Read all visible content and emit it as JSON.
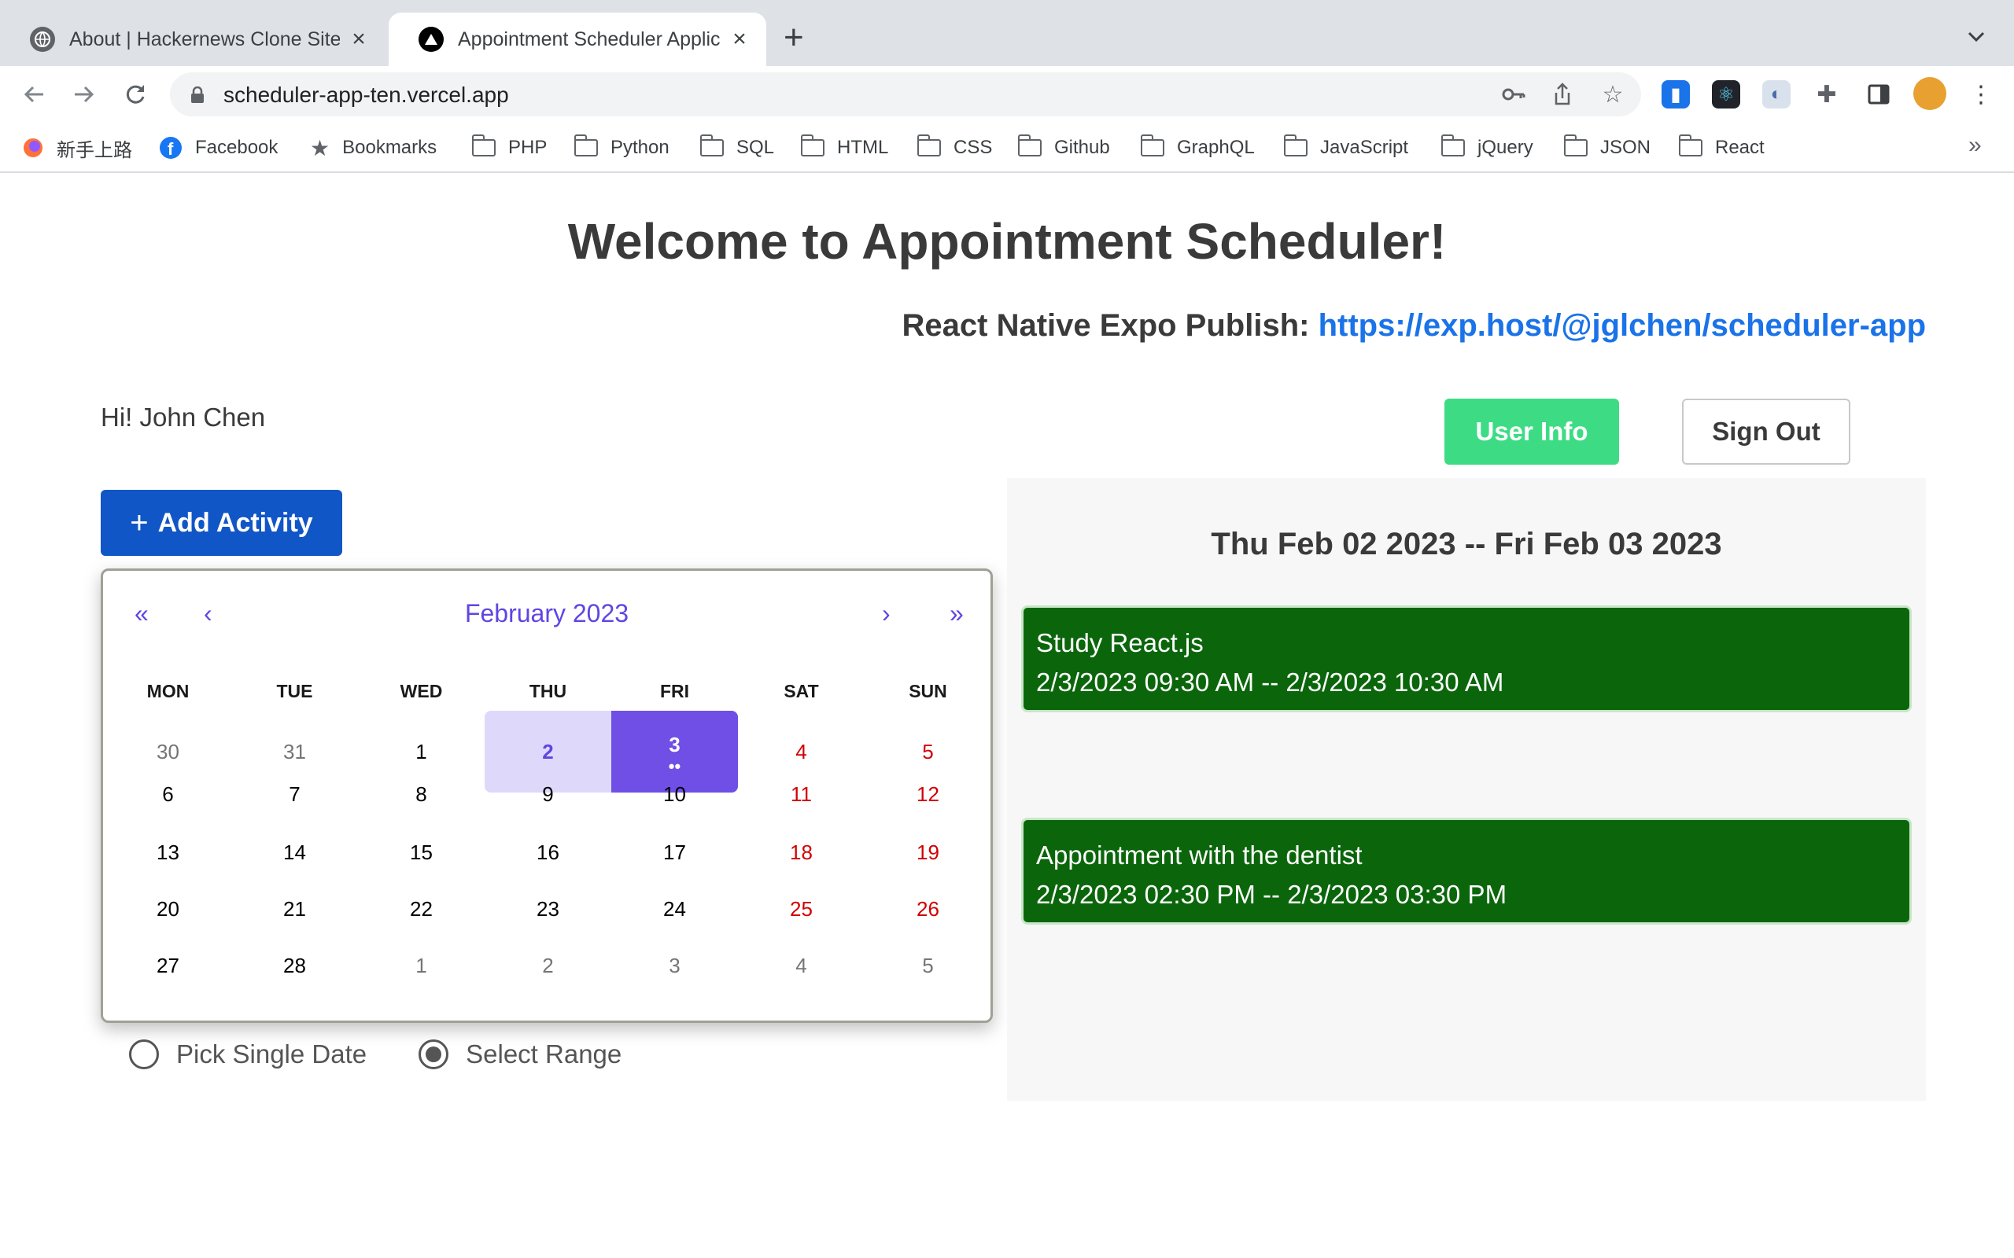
{
  "browser": {
    "tabs": [
      {
        "title": "About | Hackernews Clone Site",
        "active": false
      },
      {
        "title": "Appointment Scheduler Application",
        "active": true
      }
    ],
    "new_tab_symbol": "+",
    "url": "scheduler-app-ten.vercel.app",
    "bookmarks": [
      {
        "label": "新手上路",
        "icon": "firefox-icon"
      },
      {
        "label": "Facebook",
        "icon": "facebook-icon"
      },
      {
        "label": "Bookmarks",
        "icon": "star-icon"
      },
      {
        "label": "PHP",
        "icon": "folder-icon"
      },
      {
        "label": "Python",
        "icon": "folder-icon"
      },
      {
        "label": "SQL",
        "icon": "folder-icon"
      },
      {
        "label": "HTML",
        "icon": "folder-icon"
      },
      {
        "label": "CSS",
        "icon": "folder-icon"
      },
      {
        "label": "Github",
        "icon": "folder-icon"
      },
      {
        "label": "GraphQL",
        "icon": "folder-icon"
      },
      {
        "label": "JavaScript",
        "icon": "folder-icon"
      },
      {
        "label": "jQuery",
        "icon": "folder-icon"
      },
      {
        "label": "JSON",
        "icon": "folder-icon"
      },
      {
        "label": "React",
        "icon": "folder-icon"
      }
    ],
    "overflow_symbol": "»"
  },
  "page": {
    "title": "Welcome to Appointment Scheduler!",
    "expo_label": "React Native Expo Publish:",
    "expo_link": "https://exp.host/@jglchen/scheduler-app",
    "greeting": "Hi! John Chen",
    "user_info_label": "User Info",
    "sign_out_label": "Sign Out",
    "add_activity_plus": "+",
    "add_activity_label": "Add Activity"
  },
  "calendar": {
    "prev_year": "«",
    "prev_month": "‹",
    "month_label": "February 2023",
    "next_month": "›",
    "next_year": "»",
    "weekdays": [
      "MON",
      "TUE",
      "WED",
      "THU",
      "FRI",
      "SAT",
      "SUN"
    ],
    "weeks": [
      [
        "30",
        "31",
        "1",
        "2",
        "3",
        "4",
        "5"
      ],
      [
        "6",
        "7",
        "8",
        "9",
        "10",
        "11",
        "12"
      ],
      [
        "13",
        "14",
        "15",
        "16",
        "17",
        "18",
        "19"
      ],
      [
        "20",
        "21",
        "22",
        "23",
        "24",
        "25",
        "26"
      ],
      [
        "27",
        "28",
        "1",
        "2",
        "3",
        "4",
        "5"
      ]
    ],
    "range_start": "2",
    "range_end": "3",
    "event_dots": "••"
  },
  "mode": {
    "single_label": "Pick Single Date",
    "range_label": "Select Range",
    "selected": "range"
  },
  "schedule": {
    "range_title": "Thu Feb 02 2023 -- Fri Feb 03 2023",
    "events": [
      {
        "title": "Study React.js",
        "time": "2/3/2023 09:30 AM -- 2/3/2023 10:30 AM"
      },
      {
        "title": "Appointment with the dentist",
        "time": "2/3/2023 02:30 PM -- 2/3/2023 03:30 PM"
      }
    ]
  },
  "colors": {
    "accent_purple": "#6f4fe6",
    "range_purple": "#ded9fa",
    "add_button_blue": "#1156c7",
    "user_info_green": "#3ddc84",
    "event_green": "#0b660b",
    "weekend_red": "#d10000",
    "link_blue": "#1a73e8"
  }
}
